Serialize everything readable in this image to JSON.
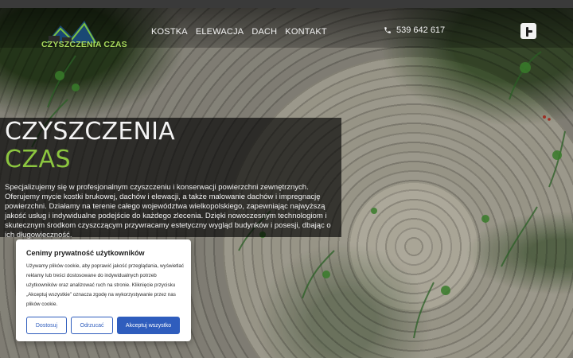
{
  "header": {
    "logo_text": "CZYSZCZENIA CZAS",
    "nav_items": [
      "KOSTKA",
      "ELEWACJA",
      "DACH",
      "KONTAKT"
    ],
    "phone": "539 642 617",
    "social_icon": "facebook-icon"
  },
  "hero": {
    "title_line1": "CZYSZCZENIA",
    "title_line2": "CZAS",
    "description": "Specjalizujemy się w profesjonalnym czyszczeniu i konserwacji powierzchni zewnętrznych. Oferujemy mycie kostki brukowej, dachów i elewacji, a także malowanie dachów i impregnację powierzchni. Działamy na terenie całego województwa wielkopolskiego, zapewniając najwyższą jakość usług i indywidualne podejście do każdego zlecenia. Dzięki nowoczesnym technologiom i skutecznym środkom czyszczącym przywracamy estetyczny wygląd budynków i posesji, dbając o ich długowieczność."
  },
  "cookie": {
    "title": "Cenimy prywatność użytkowników",
    "text": "Używamy plików cookie, aby poprawić jakość przeglądania, wyświetlać reklamy lub treści dostosowane do indywidualnych potrzeb użytkowników oraz analizować ruch na stronie. Kliknięcie przycisku „Akceptuj wszystkie” oznacza zgodę na wykorzystywanie przez nas plików cookie.",
    "buttons": {
      "settings": "Dostosuj",
      "reject": "Odrzucać",
      "accept": "Akceptuj wszystko"
    }
  },
  "colors": {
    "accent_green": "#8cc63f",
    "button_blue": "#2f5dbd",
    "overlay_dark": "#000000"
  }
}
